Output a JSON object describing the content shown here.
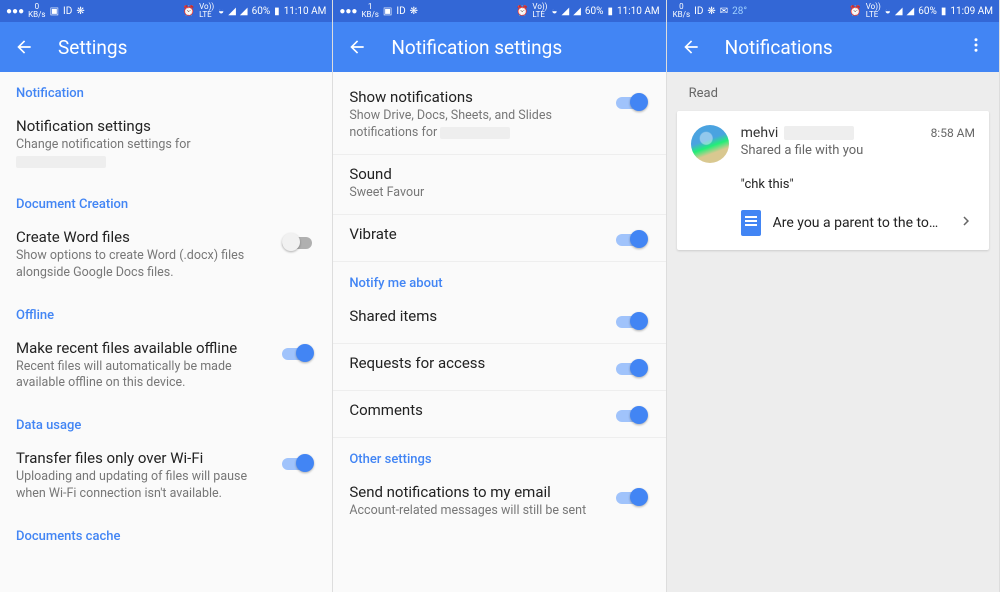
{
  "status": {
    "kbps1": "0",
    "kbps2": "1",
    "kbps_unit": "KB/s",
    "battery": "60%",
    "time12": "11:10 AM",
    "time3": "11:09 AM",
    "temp": "28°",
    "lte": "Vo))\nLTE",
    "sig": "R"
  },
  "screen1": {
    "title": "Settings",
    "sections": {
      "notification": "Notification",
      "doc_creation": "Document Creation",
      "offline": "Offline",
      "data_usage": "Data usage",
      "doc_cache": "Documents cache"
    },
    "notif_settings": {
      "title": "Notification settings",
      "sub": "Change notification settings for"
    },
    "create_word": {
      "title": "Create Word files",
      "sub": "Show options to create Word (.docx) files alongside Google Docs files."
    },
    "offline_item": {
      "title": "Make recent files available offline",
      "sub": "Recent files will automatically be made available offline on this device."
    },
    "wifi_item": {
      "title": "Transfer files only over Wi-Fi",
      "sub": "Uploading and updating of files will pause when Wi-Fi connection isn't available."
    }
  },
  "screen2": {
    "title": "Notification settings",
    "show_notif": {
      "title": "Show notifications",
      "sub": "Show Drive, Docs, Sheets, and Slides notifications for"
    },
    "sound": {
      "title": "Sound",
      "sub": "Sweet Favour"
    },
    "vibrate": {
      "title": "Vibrate"
    },
    "section_notify": "Notify me about",
    "shared": {
      "title": "Shared items"
    },
    "requests": {
      "title": "Requests for access"
    },
    "comments": {
      "title": "Comments"
    },
    "section_other": "Other settings",
    "email": {
      "title": "Send notifications to my email",
      "sub": "Account-related messages will still be sent"
    }
  },
  "screen3": {
    "title": "Notifications",
    "read_label": "Read",
    "card": {
      "name": "mehvi",
      "time": "8:58 AM",
      "action": "Shared a file with you",
      "quote": "\"chk this\"",
      "file_title": "Are you a parent to the todd…"
    }
  }
}
